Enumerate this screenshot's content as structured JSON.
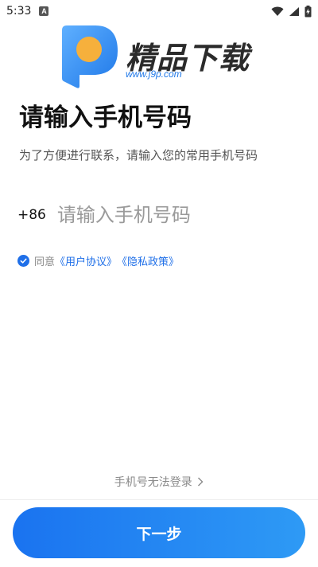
{
  "status_bar": {
    "time": "5:33",
    "notification_badge": "A",
    "icons": [
      "wifi-icon",
      "signal-icon",
      "battery-charging-icon"
    ]
  },
  "logo": {
    "name": "精品下载",
    "url": "www.j9p.com",
    "colors": {
      "blue": "#1f78e8",
      "orange": "#f6b03c",
      "text": "#2b2b2b"
    }
  },
  "login": {
    "title": "请输入手机号码",
    "subtitle": "为了方便进行联系，请输入您的常用手机号码",
    "country_code": "+86",
    "phone_placeholder": "请输入手机号码",
    "phone_value": "",
    "agree_checked": true,
    "agree_prefix": "同意",
    "user_agreement": "《用户协议》",
    "privacy_policy": "《隐私政策》",
    "cant_login": "手机号无法登录",
    "next_button": "下一步"
  },
  "theme": {
    "accent": "#1f6fe8",
    "button_gradient": [
      "#1a73f0",
      "#2e9af5"
    ]
  }
}
